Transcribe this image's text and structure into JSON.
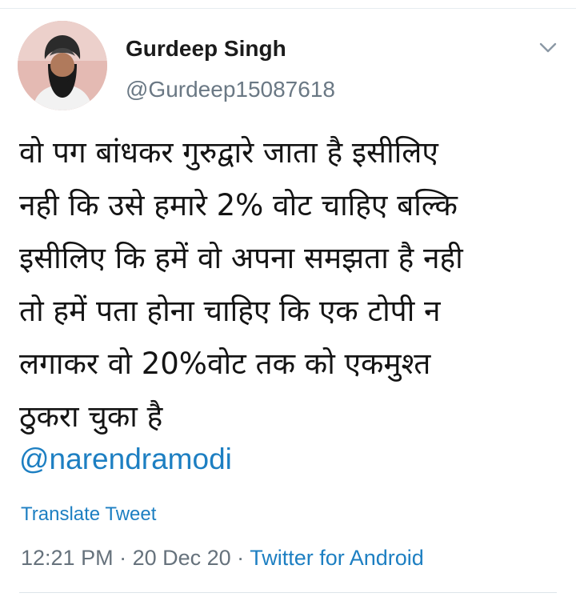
{
  "author": {
    "name": "Gurdeep Singh",
    "handle": "@Gurdeep15087618"
  },
  "tweet": {
    "text": "वो पग बांधकर गुरुद्वारे जाता है इसीलिए\nनही कि उसे हमारे 2% वोट चाहिए बल्कि\nइसीलिए कि हमें वो अपना समझता है नही\nतो हमें पता होना चाहिए कि एक टोपी न\nलगाकर वो 20%वोट तक को एकमुश्त\nठुकरा चुका है",
    "mention": "@narendramodi",
    "translate_label": "Translate Tweet"
  },
  "meta": {
    "time": "12:21 PM",
    "separator": " · ",
    "date": "20 Dec 20",
    "source": "Twitter for Android"
  },
  "icons": {
    "menu": "chevron-down-icon"
  },
  "colors": {
    "link": "#1d7fc2",
    "secondary_text": "#66727c",
    "primary_text": "#141414"
  }
}
